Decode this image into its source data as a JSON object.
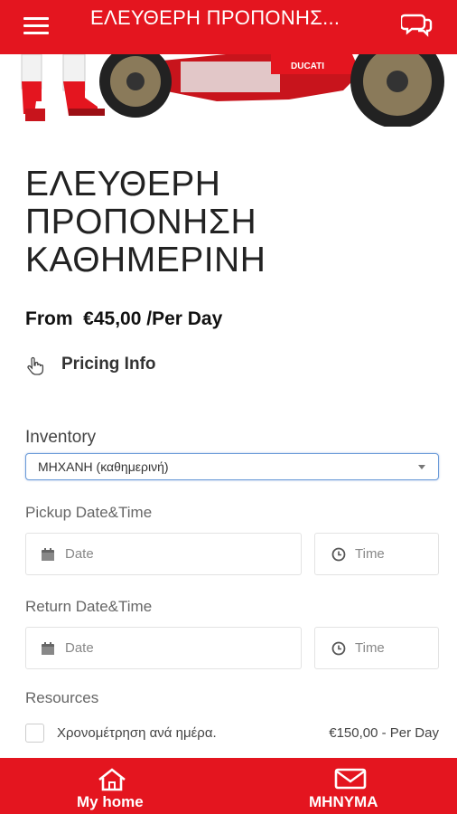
{
  "header": {
    "title": "ΕΛΕΥΘΕΡΗ ΠΡΟΠΟΝΗΣ...",
    "menu_icon": "hamburger-icon",
    "chat_icon": "chat-bubbles-icon",
    "accent_color": "#e4151f"
  },
  "hero": {
    "brand_text": "DUCATI"
  },
  "product": {
    "title": "ΕΛΕΥΘΕΡΗ ΠΡΟΠΟΝΗΣΗ ΚΑΘΗΜΕΡΙΝΗ",
    "price_text": "From  €45,00 /Per Day",
    "pricing_info_label": "Pricing Info",
    "pricing_info_icon": "pointing-hand-icon"
  },
  "form": {
    "inventory_label": "Inventory",
    "inventory_selected": "ΜΗΧΑΝΗ (καθημερινή)",
    "pickup_label": "Pickup Date&Time",
    "return_label": "Return Date&Time",
    "date_placeholder": "Date",
    "time_placeholder": "Time",
    "resources_label": "Resources",
    "resources": [
      {
        "name": "Χρονομέτρηση ανά ημέρα.",
        "price": "€150,00 - Per Day",
        "checked": false
      }
    ]
  },
  "bottom_nav": {
    "items": [
      {
        "label": "My home",
        "icon": "home-icon"
      },
      {
        "label": "ΜΗΝΥΜΑ",
        "icon": "envelope-icon"
      }
    ]
  }
}
